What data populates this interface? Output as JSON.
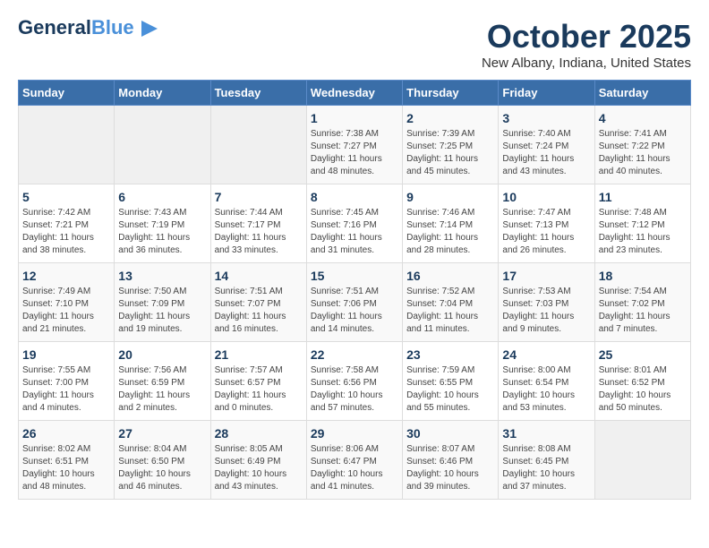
{
  "logo": {
    "general": "General",
    "blue": "Blue",
    "tagline": ""
  },
  "header": {
    "month": "October 2025",
    "location": "New Albany, Indiana, United States"
  },
  "days_of_week": [
    "Sunday",
    "Monday",
    "Tuesday",
    "Wednesday",
    "Thursday",
    "Friday",
    "Saturday"
  ],
  "weeks": [
    [
      {
        "day": "",
        "info": ""
      },
      {
        "day": "",
        "info": ""
      },
      {
        "day": "",
        "info": ""
      },
      {
        "day": "1",
        "info": "Sunrise: 7:38 AM\nSunset: 7:27 PM\nDaylight: 11 hours and 48 minutes."
      },
      {
        "day": "2",
        "info": "Sunrise: 7:39 AM\nSunset: 7:25 PM\nDaylight: 11 hours and 45 minutes."
      },
      {
        "day": "3",
        "info": "Sunrise: 7:40 AM\nSunset: 7:24 PM\nDaylight: 11 hours and 43 minutes."
      },
      {
        "day": "4",
        "info": "Sunrise: 7:41 AM\nSunset: 7:22 PM\nDaylight: 11 hours and 40 minutes."
      }
    ],
    [
      {
        "day": "5",
        "info": "Sunrise: 7:42 AM\nSunset: 7:21 PM\nDaylight: 11 hours and 38 minutes."
      },
      {
        "day": "6",
        "info": "Sunrise: 7:43 AM\nSunset: 7:19 PM\nDaylight: 11 hours and 36 minutes."
      },
      {
        "day": "7",
        "info": "Sunrise: 7:44 AM\nSunset: 7:17 PM\nDaylight: 11 hours and 33 minutes."
      },
      {
        "day": "8",
        "info": "Sunrise: 7:45 AM\nSunset: 7:16 PM\nDaylight: 11 hours and 31 minutes."
      },
      {
        "day": "9",
        "info": "Sunrise: 7:46 AM\nSunset: 7:14 PM\nDaylight: 11 hours and 28 minutes."
      },
      {
        "day": "10",
        "info": "Sunrise: 7:47 AM\nSunset: 7:13 PM\nDaylight: 11 hours and 26 minutes."
      },
      {
        "day": "11",
        "info": "Sunrise: 7:48 AM\nSunset: 7:12 PM\nDaylight: 11 hours and 23 minutes."
      }
    ],
    [
      {
        "day": "12",
        "info": "Sunrise: 7:49 AM\nSunset: 7:10 PM\nDaylight: 11 hours and 21 minutes."
      },
      {
        "day": "13",
        "info": "Sunrise: 7:50 AM\nSunset: 7:09 PM\nDaylight: 11 hours and 19 minutes."
      },
      {
        "day": "14",
        "info": "Sunrise: 7:51 AM\nSunset: 7:07 PM\nDaylight: 11 hours and 16 minutes."
      },
      {
        "day": "15",
        "info": "Sunrise: 7:51 AM\nSunset: 7:06 PM\nDaylight: 11 hours and 14 minutes."
      },
      {
        "day": "16",
        "info": "Sunrise: 7:52 AM\nSunset: 7:04 PM\nDaylight: 11 hours and 11 minutes."
      },
      {
        "day": "17",
        "info": "Sunrise: 7:53 AM\nSunset: 7:03 PM\nDaylight: 11 hours and 9 minutes."
      },
      {
        "day": "18",
        "info": "Sunrise: 7:54 AM\nSunset: 7:02 PM\nDaylight: 11 hours and 7 minutes."
      }
    ],
    [
      {
        "day": "19",
        "info": "Sunrise: 7:55 AM\nSunset: 7:00 PM\nDaylight: 11 hours and 4 minutes."
      },
      {
        "day": "20",
        "info": "Sunrise: 7:56 AM\nSunset: 6:59 PM\nDaylight: 11 hours and 2 minutes."
      },
      {
        "day": "21",
        "info": "Sunrise: 7:57 AM\nSunset: 6:57 PM\nDaylight: 11 hours and 0 minutes."
      },
      {
        "day": "22",
        "info": "Sunrise: 7:58 AM\nSunset: 6:56 PM\nDaylight: 10 hours and 57 minutes."
      },
      {
        "day": "23",
        "info": "Sunrise: 7:59 AM\nSunset: 6:55 PM\nDaylight: 10 hours and 55 minutes."
      },
      {
        "day": "24",
        "info": "Sunrise: 8:00 AM\nSunset: 6:54 PM\nDaylight: 10 hours and 53 minutes."
      },
      {
        "day": "25",
        "info": "Sunrise: 8:01 AM\nSunset: 6:52 PM\nDaylight: 10 hours and 50 minutes."
      }
    ],
    [
      {
        "day": "26",
        "info": "Sunrise: 8:02 AM\nSunset: 6:51 PM\nDaylight: 10 hours and 48 minutes."
      },
      {
        "day": "27",
        "info": "Sunrise: 8:04 AM\nSunset: 6:50 PM\nDaylight: 10 hours and 46 minutes."
      },
      {
        "day": "28",
        "info": "Sunrise: 8:05 AM\nSunset: 6:49 PM\nDaylight: 10 hours and 43 minutes."
      },
      {
        "day": "29",
        "info": "Sunrise: 8:06 AM\nSunset: 6:47 PM\nDaylight: 10 hours and 41 minutes."
      },
      {
        "day": "30",
        "info": "Sunrise: 8:07 AM\nSunset: 6:46 PM\nDaylight: 10 hours and 39 minutes."
      },
      {
        "day": "31",
        "info": "Sunrise: 8:08 AM\nSunset: 6:45 PM\nDaylight: 10 hours and 37 minutes."
      },
      {
        "day": "",
        "info": ""
      }
    ]
  ]
}
